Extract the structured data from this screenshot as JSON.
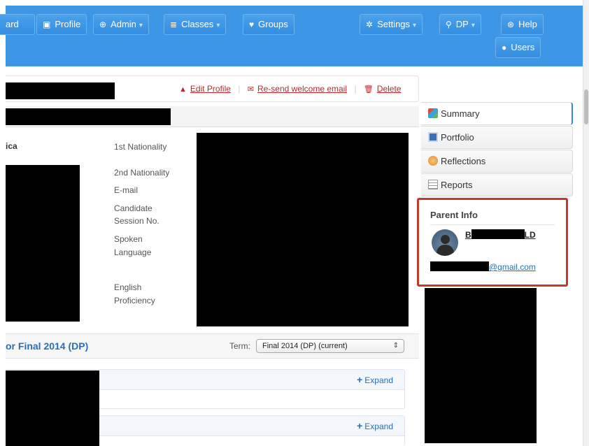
{
  "nav": {
    "items": [
      {
        "label": "ard",
        "icon": "",
        "caret": false
      },
      {
        "label": "Profile",
        "icon": "id-card-icon",
        "caret": false
      },
      {
        "label": "Admin",
        "icon": "globe-icon",
        "caret": true
      },
      {
        "label": "Classes",
        "icon": "list-icon",
        "caret": true
      },
      {
        "label": "Groups",
        "icon": "trophy-icon",
        "caret": false
      },
      {
        "label": "Settings",
        "icon": "gear-icon",
        "caret": true
      },
      {
        "label": "DP",
        "icon": "search-icon",
        "caret": true
      },
      {
        "label": "Help",
        "icon": "lifebuoy-icon",
        "caret": false
      },
      {
        "label": "Users",
        "icon": "user-icon",
        "caret": false
      }
    ]
  },
  "header": {
    "edit_profile": "Edit Profile",
    "resend": "Re-send welcome email",
    "delete": "Delete"
  },
  "info": {
    "left_partial": "ica",
    "labels": {
      "nat1": "1st Nationality",
      "nat2": "2nd Nationality",
      "email": "E-mail",
      "candidate1": "Candidate",
      "candidate2": "Session No.",
      "spoken1": "Spoken",
      "spoken2": "Language",
      "english1": "English",
      "english2": "Proficiency"
    }
  },
  "term": {
    "title": "or Final 2014 (DP)",
    "label": "Term:",
    "selected": "Final 2014 (DP) (current)"
  },
  "panels": {
    "expand": "Expand"
  },
  "sidebar": {
    "tabs": [
      {
        "label": "Summary",
        "icon": "summary-icon",
        "active": true
      },
      {
        "label": "Portfolio",
        "icon": "portfolio-icon",
        "active": false
      },
      {
        "label": "Reflections",
        "icon": "reflections-icon",
        "active": false
      },
      {
        "label": "Reports",
        "icon": "reports-icon",
        "active": false
      }
    ]
  },
  "parent": {
    "title": "Parent Info",
    "name_start": "B",
    "name_end": "LD",
    "email_suffix": "@gmail.com"
  },
  "colors": {
    "brand": "#3d96e6",
    "highlight": "#c0392b",
    "link": "#2a6fb5",
    "danger": "#c0272d"
  }
}
